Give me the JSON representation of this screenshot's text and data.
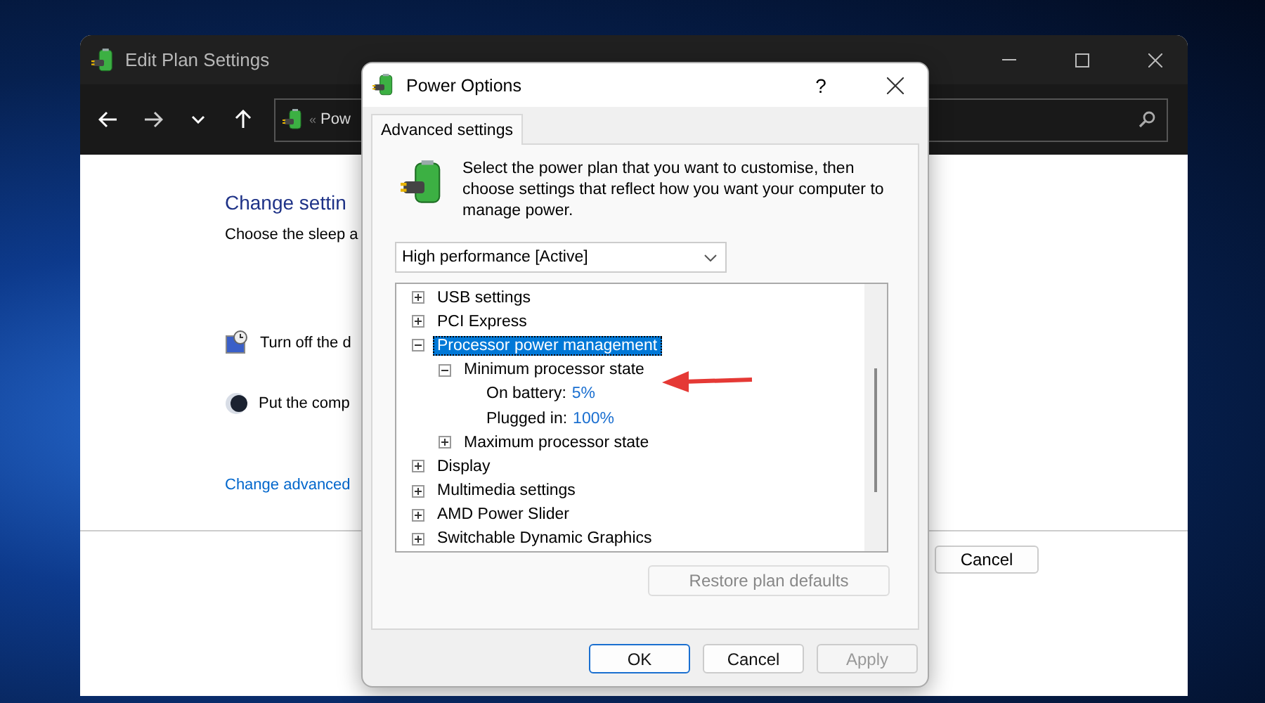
{
  "back_window": {
    "title": "Edit Plan Settings",
    "address": {
      "separator": "«",
      "path": "Pow"
    },
    "heading": "Change settin",
    "subtitle": "Choose the sleep a",
    "settings": [
      {
        "kind": "display",
        "label": "Turn off the d"
      },
      {
        "kind": "sleep",
        "label": "Put the comp"
      }
    ],
    "link": "Change advanced",
    "button": "Cancel"
  },
  "dialog": {
    "title": "Power Options",
    "help": "?",
    "tabs": [
      {
        "label": "Advanced settings",
        "selected": true
      }
    ],
    "intro": "Select the power plan that you want to customise, then choose settings that reflect how you want your computer to manage power.",
    "plan": "High performance [Active]",
    "tree": [
      {
        "kind": "group",
        "label": "USB settings",
        "expanded": false,
        "selected": false
      },
      {
        "kind": "group",
        "label": "PCI Express",
        "expanded": false,
        "selected": false
      },
      {
        "kind": "group",
        "label": "Processor power management",
        "expanded": true,
        "selected": true,
        "children": [
          {
            "kind": "group",
            "label": "Minimum processor state",
            "expanded": true,
            "selected": false,
            "children": [
              {
                "kind": "value",
                "label": "On battery:",
                "value": "5%"
              },
              {
                "kind": "value",
                "label": "Plugged in:",
                "value": "100%"
              }
            ]
          },
          {
            "kind": "group",
            "label": "Maximum processor state",
            "expanded": false,
            "selected": false
          }
        ]
      },
      {
        "kind": "group",
        "label": "Display",
        "expanded": false,
        "selected": false
      },
      {
        "kind": "group",
        "label": "Multimedia settings",
        "expanded": false,
        "selected": false
      },
      {
        "kind": "group",
        "label": "AMD Power Slider",
        "expanded": false,
        "selected": false
      },
      {
        "kind": "group",
        "label": "Switchable Dynamic Graphics",
        "expanded": false,
        "selected": false
      }
    ],
    "restore": {
      "label": "Restore plan defaults",
      "disabled": true
    },
    "buttons": [
      {
        "label": "OK",
        "default": true,
        "disabled": false
      },
      {
        "label": "Cancel",
        "default": false,
        "disabled": false
      },
      {
        "label": "Apply",
        "default": false,
        "disabled": true
      }
    ]
  }
}
